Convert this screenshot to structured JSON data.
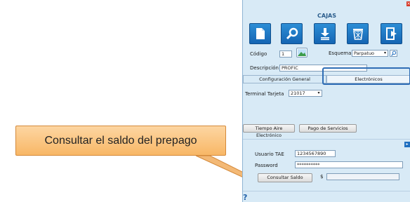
{
  "callout": {
    "text": "Consultar el saldo del prepago"
  },
  "window": {
    "title": "CAJAS",
    "close_glyph": "×",
    "toolbar": [
      {
        "name": "new-document-icon"
      },
      {
        "name": "search-icon"
      },
      {
        "name": "save-icon"
      },
      {
        "name": "recycle-bin-icon"
      },
      {
        "name": "exit-icon"
      }
    ],
    "fields": {
      "codigo_label": "Código",
      "codigo_value": "1",
      "esquema_label": "Esquema",
      "esquema_value": "Parpatuo",
      "descripcion_label": "Descripción",
      "descripcion_value": "PROFIC"
    },
    "tabs": [
      {
        "label": "Configuración General"
      },
      {
        "label": "Electrónicos"
      }
    ],
    "terminal": {
      "label": "Terminal Tarjeta",
      "value": "21017"
    },
    "buttons": {
      "tiempo_aire": "Tiempo Aire Electrónico",
      "pago_servicios": "Pago de Servicios"
    },
    "credentials": {
      "usuario_label": "Usuario TAE",
      "usuario_value": "1234567890",
      "password_label": "Password",
      "password_value": "**********"
    },
    "consult_button": "Consultar Saldo",
    "currency_symbol": "$",
    "help_glyph": "?"
  },
  "colors": {
    "accent": "#1f6fc0",
    "window_bg": "#d8eaf6",
    "callout_bg": "#f8b766",
    "highlight_border": "#2f6db5"
  }
}
